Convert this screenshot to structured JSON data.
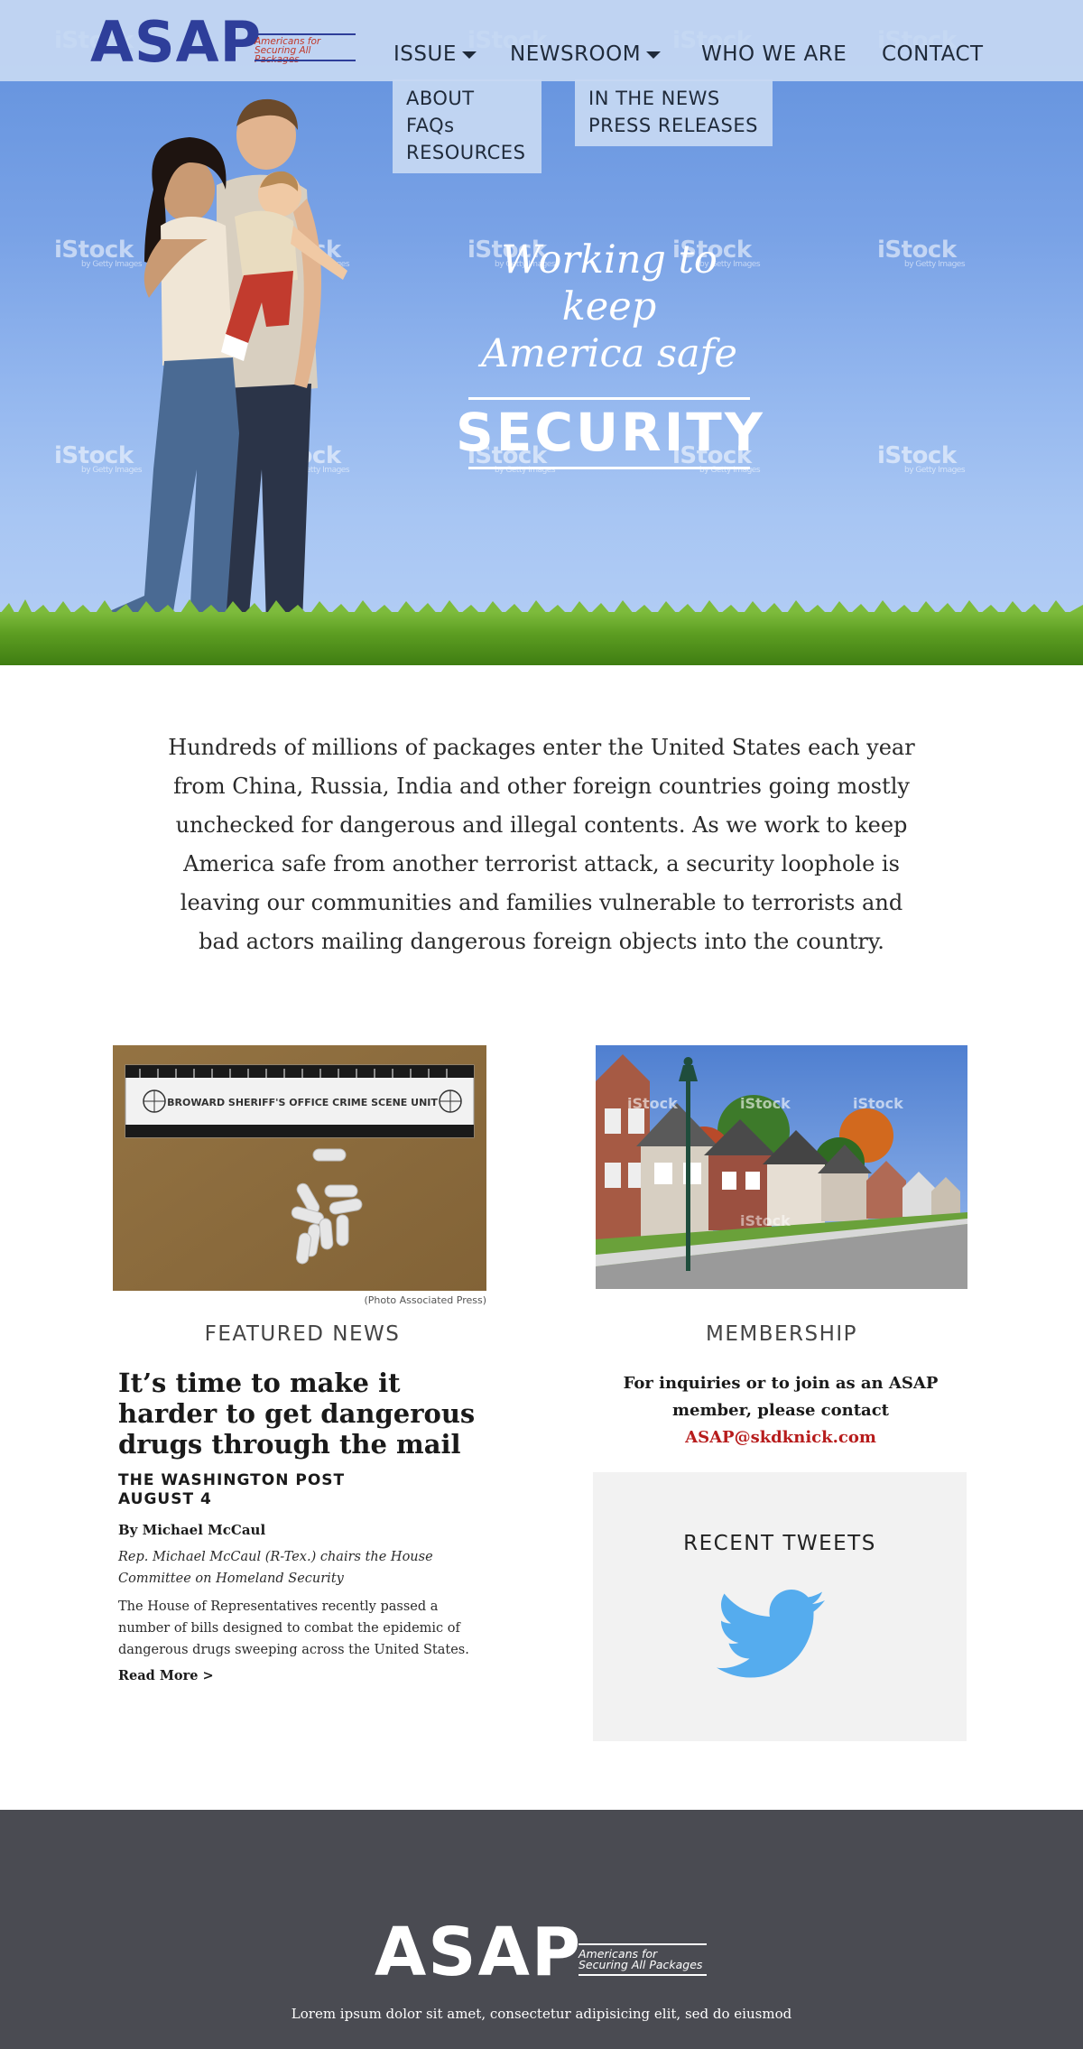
{
  "brand": {
    "logo_letters": "ASAP",
    "logo_tagline": "Americans for Securing All Packages",
    "primary_color": "#2e3e9a",
    "tagline_color": "#c0392b"
  },
  "nav": {
    "items": [
      {
        "label": "ISSUE",
        "has_dropdown": true
      },
      {
        "label": "NEWSROOM",
        "has_dropdown": true
      },
      {
        "label": "WHO WE ARE",
        "has_dropdown": false
      },
      {
        "label": "CONTACT",
        "has_dropdown": false
      }
    ],
    "issue_menu": [
      "ABOUT",
      "FAQs",
      "RESOURCES"
    ],
    "newsroom_menu": [
      "IN THE NEWS",
      "PRESS RELEASES"
    ]
  },
  "hero": {
    "tagline_line1": "Working to keep",
    "tagline_line2": "America safe",
    "keyword": "SECURITY",
    "watermark": "iStock",
    "watermark_sub": "by Getty Images"
  },
  "intro": {
    "text": "Hundreds of millions of packages enter the United States each year from China, Russia, India and other foreign countries going mostly unchecked for dangerous and illegal contents. As we work to keep America safe from another terrorist attack, a security loophole is leaving our communities and families vulnerable to terrorists and bad actors mailing dangerous foreign objects into the country."
  },
  "featured": {
    "photo_label": "BROWARD SHERIFF'S OFFICE CRIME SCENE UNIT",
    "photo_credit": "(Photo Associated Press)",
    "heading": "FEATURED NEWS",
    "title": "It’s time to make it harder to get dangerous drugs through the mail",
    "source": "THE WASHINGTON POST",
    "date": "AUGUST 4",
    "byline": "By Michael McCaul",
    "role": "Rep. Michael McCaul (R-Tex.) chairs the House Committee on Homeland Security",
    "body": "The House of Representatives recently passed a number of bills designed to combat the epidemic of dangerous drugs sweeping across the United States.",
    "read_more": "Read More >"
  },
  "membership": {
    "heading": "MEMBERSHIP",
    "text": "For inquiries or to join as an ASAP member, please contact",
    "email": "ASAP@skdknick.com",
    "email_color": "#b71c1c"
  },
  "tweets": {
    "heading": "RECENT TWEETS",
    "icon": "twitter-bird-icon",
    "icon_color": "#55acee"
  },
  "footer": {
    "logo_letters": "ASAP",
    "logo_tagline": "Americans for Securing All Packages",
    "text": "Lorem ipsum dolor sit amet, consectetur adipisicing elit, sed do eiusmod",
    "background": "#4a4b52"
  }
}
